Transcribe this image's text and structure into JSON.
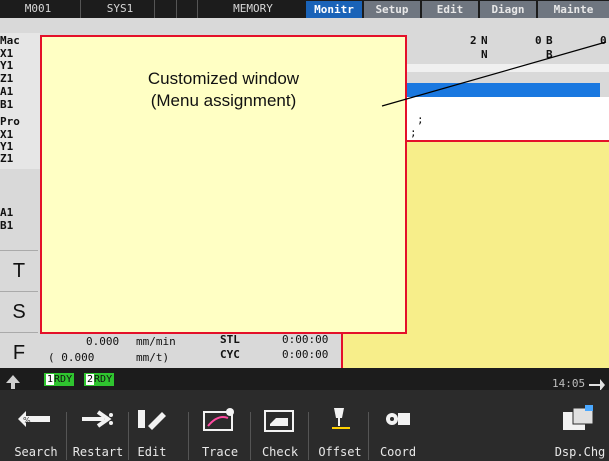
{
  "topbar": {
    "cells": [
      "M001",
      "SYS1",
      "MEMORY"
    ],
    "tabs": [
      "Monitr",
      "Setup",
      "Edit",
      "Diagn",
      "Mainte"
    ],
    "active_tab": "Monitr"
  },
  "left_panel": {
    "machine_label": "Mac",
    "machine_axes": [
      "X1",
      "Y1",
      "Z1",
      "A1",
      "B1"
    ],
    "program_label": "Pro",
    "program_axes": [
      "X1",
      "Y1",
      "Z1",
      "A1",
      "B1"
    ],
    "t_label": "T",
    "s_label": "S",
    "f_label": "F"
  },
  "partial_values": {
    "r1a": "2",
    "r1b": "N",
    "r1c": "0",
    "r1d": "B",
    "r1e": "0",
    "r2a": "N",
    "r2b": "B",
    "semicolon1": ";",
    "semicolon2": ";"
  },
  "feed": {
    "value": "0.000",
    "unit": "mm/min",
    "paren_value": "( 0.000",
    "paren_unit": "mm/t)"
  },
  "timers": {
    "stl_label": "STL",
    "stl_value": "0:00:00",
    "cyc_label": "CYC",
    "cyc_value": "0:00:00"
  },
  "customized_window": {
    "line1": "Customized window",
    "line2": "(Menu assignment)"
  },
  "status": {
    "rdy1_num": "1",
    "rdy1": "RDY",
    "rdy2_num": "2",
    "rdy2": "RDY",
    "clock": "14:05"
  },
  "menu": [
    {
      "label": "Search",
      "icon": "search-icon"
    },
    {
      "label": "Restart",
      "icon": "restart-icon"
    },
    {
      "label": "Edit",
      "icon": "edit-icon"
    },
    {
      "label": "Trace",
      "icon": "trace-icon"
    },
    {
      "label": "Check",
      "icon": "check-icon"
    },
    {
      "label": "Offset",
      "icon": "offset-icon"
    },
    {
      "label": "Coord",
      "icon": "coord-icon"
    },
    {
      "label": "Dsp.Chg",
      "icon": "display-change-icon"
    }
  ],
  "colors": {
    "active_tab": "#1a63b8",
    "window_fill": "#ffffc4",
    "window2_fill": "#f7ee8a",
    "window_border": "#e4102a",
    "ready": "#2fc42f"
  }
}
